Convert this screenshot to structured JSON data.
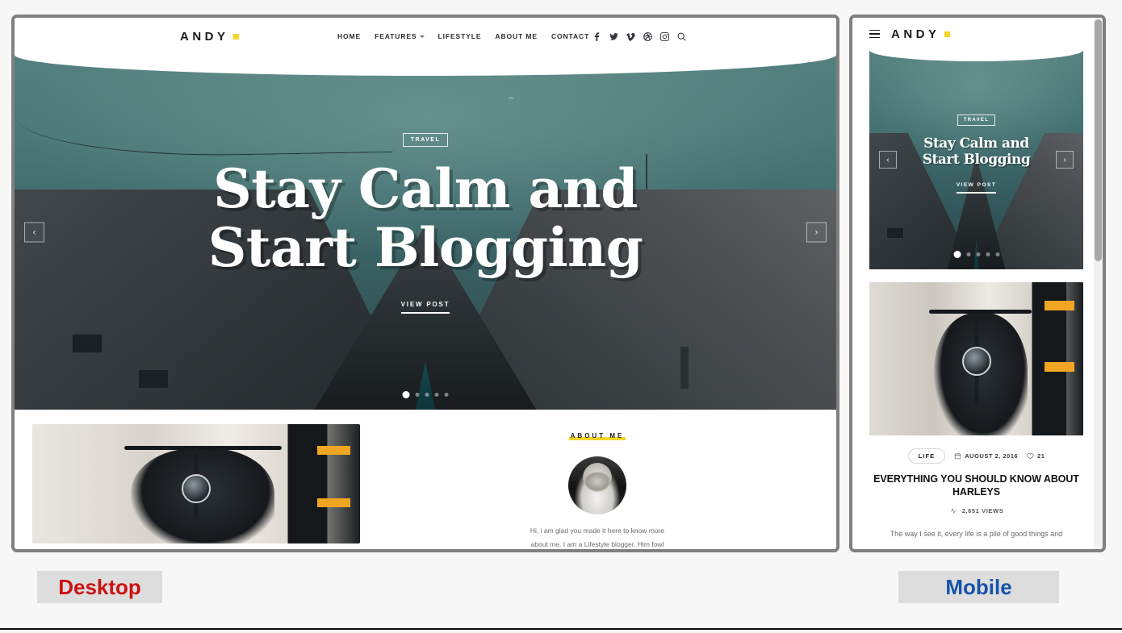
{
  "labels": {
    "desktop": "Desktop",
    "mobile": "Mobile"
  },
  "site": {
    "logo": {
      "text": "ANDY",
      "dot_color": "#f5d423"
    },
    "nav": [
      {
        "label": "HOME",
        "has_caret": false
      },
      {
        "label": "FEATURES",
        "has_caret": true
      },
      {
        "label": "LIFESTYLE",
        "has_caret": false
      },
      {
        "label": "ABOUT ME",
        "has_caret": false
      },
      {
        "label": "CONTACT",
        "has_caret": false
      }
    ],
    "social": [
      "facebook-icon",
      "twitter-icon",
      "vimeo-icon",
      "dribbble-icon",
      "instagram-icon",
      "search-icon"
    ],
    "hero": {
      "category": "TRAVEL",
      "title_line1": "Stay Calm and",
      "title_line2": "Start Blogging",
      "cta": "VIEW POST",
      "prev": "‹",
      "next": "›",
      "dots": 5,
      "active_dot": 1
    },
    "about": {
      "heading": "ABOUT ME",
      "text": "Hi, i am glad you made it here to know more about me. I am a Lifestyle blogger. Him fowl"
    },
    "post": {
      "category": "LIFE",
      "date": "AUGUST 2, 2016",
      "likes": "21",
      "title": "EVERYTHING YOU SHOULD KNOW ABOUT HARLEYS",
      "views": "2,651 VIEWS",
      "excerpt": "The way I see it, every life is a pile of good things and"
    }
  },
  "colors": {
    "accent_yellow": "#f5d423",
    "hero_teal": "#3f6a6b",
    "frame_border": "#808080",
    "label_desktop": "#cc1111",
    "label_mobile": "#1653a8",
    "page_bg": "#f7f7f7"
  }
}
